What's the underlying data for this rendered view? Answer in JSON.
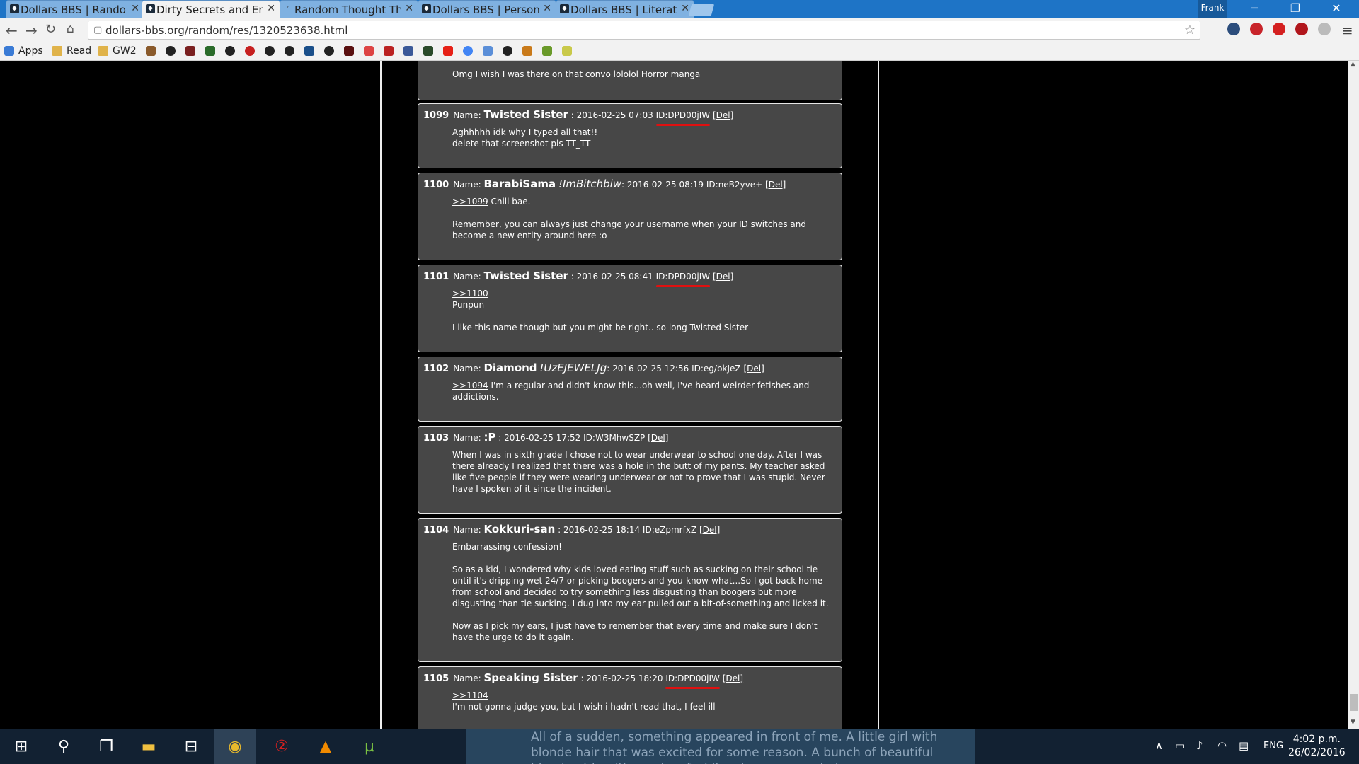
{
  "browser": {
    "tabs": [
      {
        "title": "Dollars BBS | Random",
        "active": false
      },
      {
        "title": "Dirty Secrets and Emba",
        "active": true
      },
      {
        "title": "Random Thought Thr",
        "active": false
      },
      {
        "title": "Dollars BBS | Persona",
        "active": false
      },
      {
        "title": "Dollars BBS | Literatu",
        "active": false
      }
    ],
    "user": "Frank",
    "url": "dollars-bbs.org/random/res/1320523638.html",
    "bookmarks": {
      "apps": "Apps",
      "read": "Read",
      "gw2": "GW2"
    }
  },
  "thread": {
    "top_post": {
      "body": "Omg I wish I was there on that convo lololol Horror manga"
    },
    "posts": [
      {
        "num": "1099",
        "name_label": "Name:",
        "name": "Twisted Sister",
        "trip": "",
        "date": ": 2016-02-25 07:03",
        "id": "ID:DPD00jIW",
        "del": "[Del]",
        "ref": "",
        "body": "Aghhhhh idk why I typed all that!!\ndelete that screenshot pls TT_TT",
        "marked": true
      },
      {
        "num": "1100",
        "name_label": "Name:",
        "name": "BarabiSama",
        "trip": "!ImBitchbiw",
        "date": ": 2016-02-25 08:19",
        "id": "ID:neB2yve+",
        "del": "[Del]",
        "ref": ">>1099",
        "body": " Chill bae.\n\nRemember, you can always just change your username when your ID switches and become a new entity around here :o",
        "marked": false
      },
      {
        "num": "1101",
        "name_label": "Name:",
        "name": "Twisted Sister",
        "trip": "",
        "date": ": 2016-02-25 08:41",
        "id": "ID:DPD00jIW",
        "del": "[Del]",
        "ref": ">>1100",
        "body": "\nPunpun\n\nI like this name though but you might be right.. so long Twisted Sister",
        "marked": true
      },
      {
        "num": "1102",
        "name_label": "Name:",
        "name": "Diamond",
        "trip": "!UzEJEWELJg",
        "date": ": 2016-02-25 12:56",
        "id": "ID:eg/bkJeZ",
        "del": "[Del]",
        "ref": ">>1094",
        "body": " I'm a regular and didn't know this...oh well, I've heard weirder fetishes and addictions.",
        "marked": false
      },
      {
        "num": "1103",
        "name_label": "Name:",
        "name": ":P",
        "trip": "",
        "date": ": 2016-02-25 17:52",
        "id": "ID:W3MhwSZP",
        "del": "[Del]",
        "ref": "",
        "body": "When I was in sixth grade I chose not to wear underwear to school one day. After I was there already I realized that there was a hole in the butt of my pants. My teacher asked like five people if they were wearing underwear or not to prove that I was stupid. Never have I spoken of it since the incident.",
        "marked": false
      },
      {
        "num": "1104",
        "name_label": "Name:",
        "name": "Kokkuri-san",
        "trip": "",
        "date": ": 2016-02-25 18:14",
        "id": "ID:eZpmrfxZ",
        "del": "[Del]",
        "ref": "",
        "body": "Embarrassing confession!\n\nSo as a kid, I wondered why kids loved eating stuff such as sucking on their school tie until it's dripping wet 24/7 or picking boogers and-you-know-what...So I got back home from school and decided to try something less disgusting than boogers but more disgusting than tie sucking. I dug into my ear pulled out a bit-of-something and licked it.\n\nNow as I pick my ears, I just have to remember that every time and make sure I don't have the urge to do it again.",
        "marked": false
      },
      {
        "num": "1105",
        "name_label": "Name:",
        "name": "Speaking Sister",
        "trip": "",
        "date": ": 2016-02-25 18:20",
        "id": "ID:DPD00jIW",
        "del": "[Del]",
        "ref": ">>1104",
        "body": "\nI'm not gonna judge you, but I wish i hadn't read that, I feel ill",
        "marked": true
      }
    ]
  },
  "taskbar": {
    "underlay_text": "All of a sudden, something appeared in front of me. A little girl with blonde hair that was excited for some reason. A bunch of beautiful blonde girls with a pairs of white wings surrounded me.",
    "lang": "ENG",
    "time": "4:02 p.m.",
    "date": "26/02/2016"
  },
  "colors": {
    "accent": "#1e74c6",
    "post_bg": "#474747",
    "id_mark": "#e01010"
  }
}
